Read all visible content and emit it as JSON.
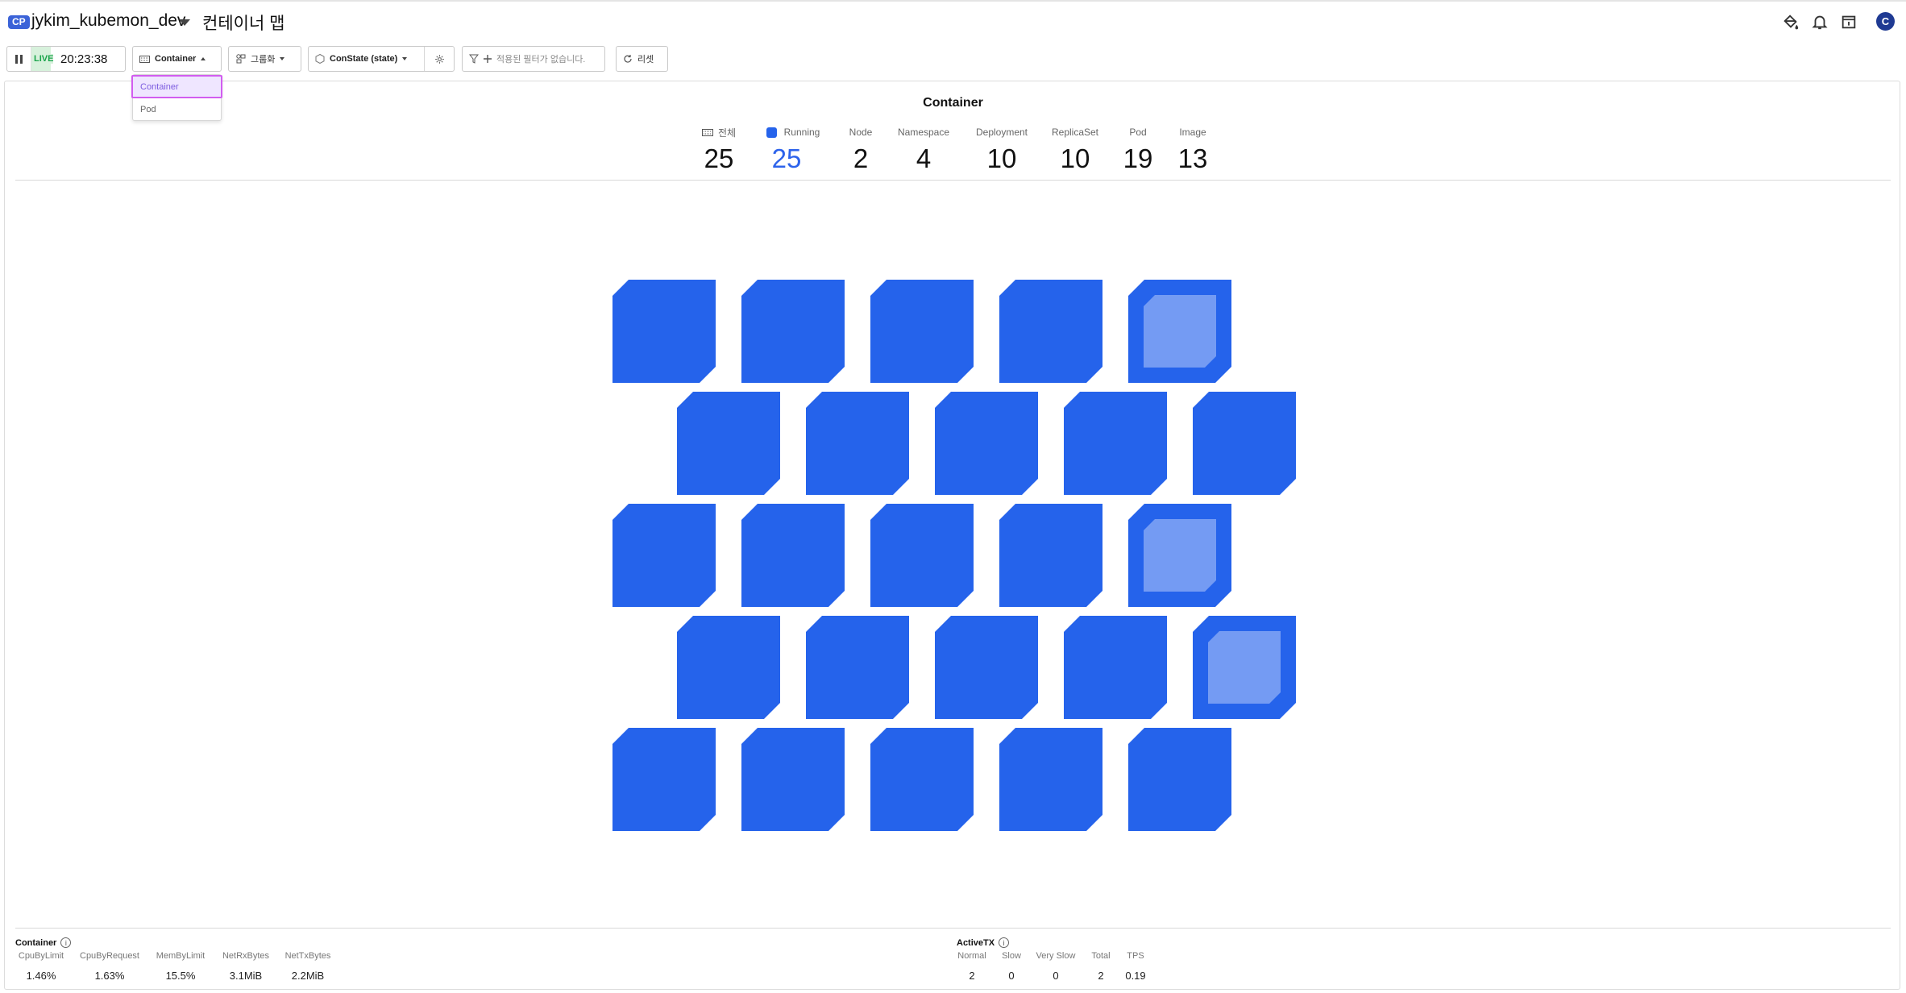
{
  "header": {
    "badge": "CP",
    "project_name": "jykim_kubemon_dev",
    "page_title": "컨테이너 맵",
    "icons": [
      "paint-bucket-icon",
      "bell-icon",
      "calendar-icon"
    ],
    "avatar_letter": "C"
  },
  "toolbar": {
    "live_label": "LIVE",
    "live_time": "20:23:38",
    "view_label": "Container",
    "group_label": "그룹화",
    "state_label": "ConState (state)",
    "filter_placeholder": "적용된 필터가 없습니다.",
    "reset_label": "리셋"
  },
  "dropdown": {
    "options": [
      "Container",
      "Pod"
    ],
    "selected": "Container"
  },
  "summary": {
    "title": "Container",
    "stats": [
      {
        "label": "전체",
        "value": "25"
      },
      {
        "label": "Running",
        "value": "25"
      },
      {
        "label": "Node",
        "value": "2"
      },
      {
        "label": "Namespace",
        "value": "4"
      },
      {
        "label": "Deployment",
        "value": "10"
      },
      {
        "label": "ReplicaSet",
        "value": "10"
      },
      {
        "label": "Pod",
        "value": "19"
      },
      {
        "label": "Image",
        "value": "13"
      }
    ]
  },
  "map": {
    "tile_color": "#2563eb",
    "highlight_color": "#749bf3",
    "rows": [
      [
        false,
        false,
        false,
        false,
        true
      ],
      [
        false,
        false,
        false,
        false,
        false
      ],
      [
        false,
        false,
        false,
        false,
        true
      ],
      [
        false,
        false,
        false,
        false,
        true
      ],
      [
        false,
        false,
        false,
        false,
        false
      ]
    ]
  },
  "container_metrics": {
    "title": "Container",
    "items": [
      {
        "label": "CpuByLimit",
        "value": "1.46%"
      },
      {
        "label": "CpuByRequest",
        "value": "1.63%"
      },
      {
        "label": "MemByLimit",
        "value": "15.5%"
      },
      {
        "label": "NetRxBytes",
        "value": "3.1MiB"
      },
      {
        "label": "NetTxBytes",
        "value": "2.2MiB"
      }
    ]
  },
  "activetx_metrics": {
    "title": "ActiveTX",
    "items": [
      {
        "label": "Normal",
        "value": "2"
      },
      {
        "label": "Slow",
        "value": "0"
      },
      {
        "label": "Very Slow",
        "value": "0"
      },
      {
        "label": "Total",
        "value": "2"
      },
      {
        "label": "TPS",
        "value": "0.19"
      }
    ]
  }
}
